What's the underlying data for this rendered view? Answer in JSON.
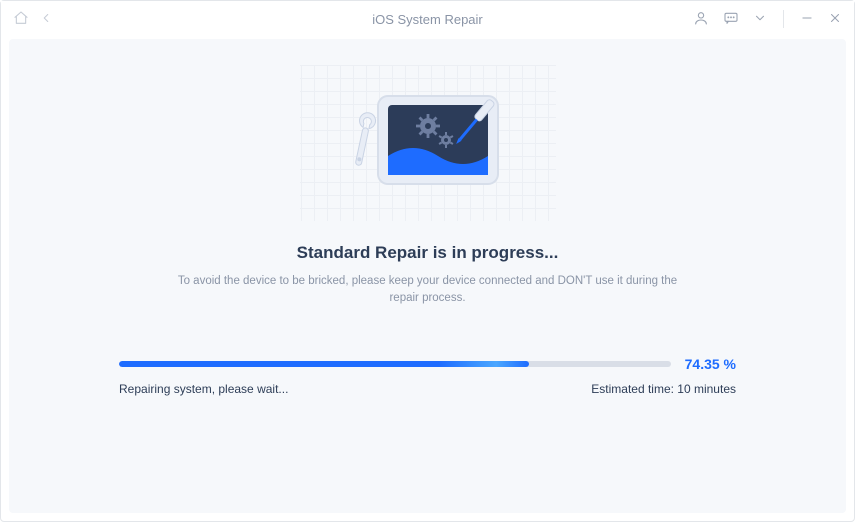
{
  "titlebar": {
    "title": "iOS System Repair"
  },
  "heading": "Standard Repair is in progress...",
  "subtext": "To avoid the device to be bricked, please keep your device connected and DON'T use it during the repair process.",
  "progress": {
    "percent_value": 74.35,
    "percent_label": "74.35 %",
    "bar_width": "74.35%"
  },
  "status": {
    "left": "Repairing system, please wait...",
    "right": "Estimated time: 10 minutes"
  }
}
